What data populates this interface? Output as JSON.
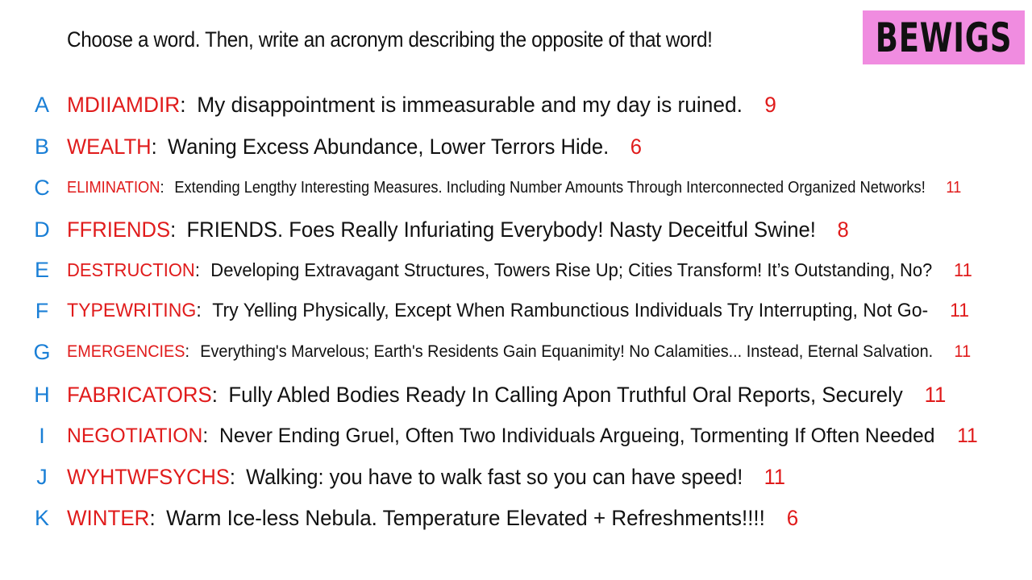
{
  "prompt": "Choose a word. Then, write an acronym describing the opposite of that word!",
  "logo": {
    "text": "BEWIGS",
    "background_color": "#f08ce0"
  },
  "colors": {
    "letter": "#1a7fd6",
    "word": "#e01b1b",
    "text": "#111111"
  },
  "entries": [
    {
      "letter": "A",
      "word": "MDIIAMDIR",
      "colon": ":",
      "definition": "My disappointment is immeasurable and my day is ruined.",
      "count": "9"
    },
    {
      "letter": "B",
      "word": "WEALTH",
      "colon": ":",
      "definition": "Waning Excess Abundance, Lower Terrors Hide.",
      "count": "6"
    },
    {
      "letter": "C",
      "word": "ELIMINATION",
      "colon": ":",
      "definition": "Extending Lengthy Interesting Measures. Including Number Amounts Through Interconnected Organized Networks!",
      "count": "11"
    },
    {
      "letter": "D",
      "word": "FFRIENDS",
      "colon": ":",
      "definition": "FRIENDS. Foes Really Infuriating Everybody! Nasty Deceitful Swine!",
      "count": "8"
    },
    {
      "letter": "E",
      "word": "DESTRUCTION",
      "colon": ":",
      "definition": "Developing Extravagant Structures, Towers Rise Up; Cities Transform! It’s Outstanding, No?",
      "count": "11"
    },
    {
      "letter": "F",
      "word": "TYPEWRITING",
      "colon": ":",
      "definition": "Try Yelling Physically, Except When Rambunctious Individuals Try Interrupting, Not Go-",
      "count": "11"
    },
    {
      "letter": "G",
      "word": "EMERGENCIES",
      "colon": ":",
      "definition": "Everything's Marvelous; Earth's Residents Gain Equanimity! No Calamities... Instead, Eternal Salvation.",
      "count": "11"
    },
    {
      "letter": "H",
      "word": "FABRICATORS",
      "colon": ":",
      "definition": "Fully Abled Bodies Ready In Calling Apon Truthful Oral Reports, Securely",
      "count": "11"
    },
    {
      "letter": "I",
      "word": "NEGOTIATION",
      "colon": ":",
      "definition": "Never Ending Gruel, Often Two Individuals Argueing, Tormenting If Often Needed",
      "count": "11"
    },
    {
      "letter": "J",
      "word": "WYHTWFSYCHS",
      "colon": ":",
      "definition": "Walking: you have to walk fast so you can have speed!",
      "count": "11"
    },
    {
      "letter": "K",
      "word": "WINTER",
      "colon": ":",
      "definition": "Warm Ice-less Nebula. Temperature Elevated + Refreshments!!!!",
      "count": "6"
    }
  ]
}
